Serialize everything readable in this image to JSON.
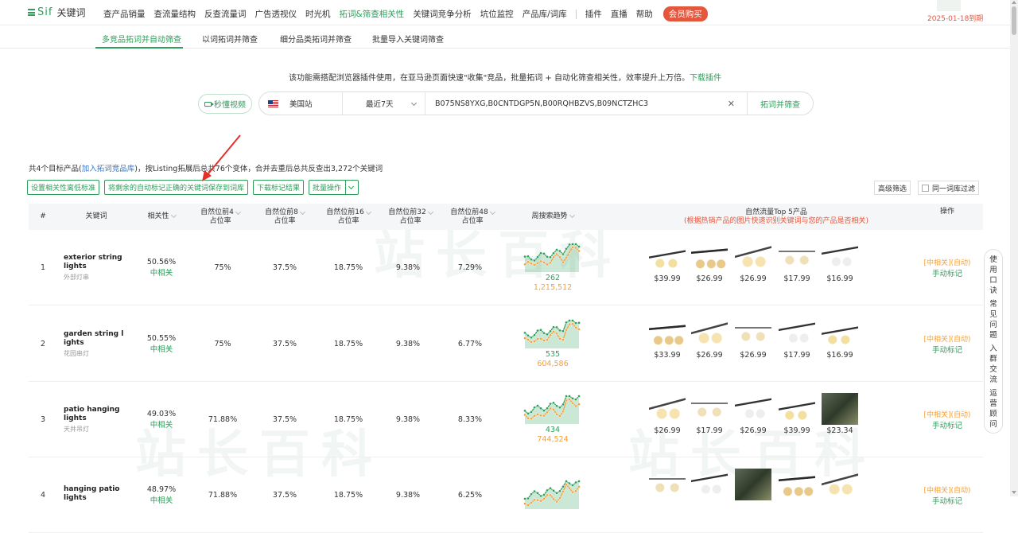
{
  "header": {
    "logo_brand": "Sif",
    "logo_sub": "关键词",
    "nav": [
      "查产品销量",
      "查流量结构",
      "反查流量词",
      "广告透视仪",
      "时光机",
      "拓词&筛查相关性",
      "关键词竞争分析",
      "坑位监控",
      "产品库/词库"
    ],
    "nav_right": [
      "插件",
      "直播",
      "帮助"
    ],
    "vip_label": "会员购买",
    "date": "2025-01-18到期"
  },
  "subnav": [
    "多竞品拓词并自动筛查",
    "以词拓词并筛查",
    "细分品类拓词并筛查",
    "批量导入关键词筛查"
  ],
  "intro": {
    "text": "该功能需搭配浏览器插件使用，在亚马逊页面快速\"收集\"竞品，批量拓词 + 自动化筛查相关性，效率提升上万倍。",
    "link": "下载插件"
  },
  "search": {
    "video_btn": "秒懂视频",
    "site": "美国站",
    "range": "最近7天",
    "asins": "B075NS8YXG,B0CNTDGP5N,B00RQHBZVS,B09NCTZHC3",
    "submit": "拓词并筛查"
  },
  "summary": {
    "prefix": "共4个目标产品(",
    "link": "加入拓词竞品库",
    "suffix": ")，按Listing拓展后总共76个变体，合并去重后总共反查出3,272个关键词"
  },
  "actions": {
    "set_standard": "设置相关性离低标准",
    "save_rest": "将剩余的自动标记正确的关键词保存到词库",
    "download": "下载标记结果",
    "batch": "批量操作"
  },
  "filters": {
    "advanced": "高级筛选",
    "same_lib": "同一词库过滤"
  },
  "columns": {
    "idx": "#",
    "keyword": "关键词",
    "relevance": "相关性",
    "top4_a": "自然位前4",
    "top4_b": "占位率",
    "top8_a": "自然位前8",
    "top8_b": "占位率",
    "top16_a": "自然位前16",
    "top16_b": "占位率",
    "top32_a": "自然位前32",
    "top32_b": "占位率",
    "top48_a": "自然位前48",
    "top48_b": "占位率",
    "trend": "周搜索趋势",
    "top5": "自然流量Top 5产品",
    "top5_note": "(根据热销产品的图片快速识别关键词与您的产品是否相关)",
    "op": "操作"
  },
  "rows": [
    {
      "idx": "1",
      "kw": "exterior string lights",
      "cn": "外部灯串",
      "rel": "50.56%",
      "lvl": "中相关",
      "t4": "75%",
      "t8": "37.5%",
      "t16": "18.75%",
      "t32": "9.38%",
      "t48": "7.29%",
      "rank": "262",
      "vol": "1,215,512",
      "prices": [
        "$39.99",
        "$26.99",
        "$26.99",
        "$17.99",
        "$16.99"
      ],
      "op_a": "[中相关](自动)",
      "op_b": "手动标记"
    },
    {
      "idx": "2",
      "kw": "garden string lights",
      "cn": "花园串灯",
      "rel": "50.55%",
      "lvl": "中相关",
      "t4": "75%",
      "t8": "37.5%",
      "t16": "18.75%",
      "t32": "9.38%",
      "t48": "6.77%",
      "rank": "535",
      "vol": "604,586",
      "prices": [
        "$33.99",
        "$26.99",
        "$26.99",
        "$17.99",
        "$16.99"
      ],
      "op_a": "[中相关](自动)",
      "op_b": "手动标记"
    },
    {
      "idx": "3",
      "kw": "patio hanging lights",
      "cn": "天井吊灯",
      "rel": "49.03%",
      "lvl": "中相关",
      "t4": "71.88%",
      "t8": "37.5%",
      "t16": "18.75%",
      "t32": "9.38%",
      "t48": "8.33%",
      "rank": "434",
      "vol": "744,524",
      "prices": [
        "$26.99",
        "$17.99",
        "$26.99",
        "$39.99",
        "$23.34"
      ],
      "op_a": "[中相关](自动)",
      "op_b": "手动标记"
    },
    {
      "idx": "4",
      "kw": "hanging patio lights",
      "cn": "",
      "rel": "48.97%",
      "lvl": "中相关",
      "t4": "71.88%",
      "t8": "37.5%",
      "t16": "18.75%",
      "t32": "9.38%",
      "t48": "6.25%",
      "rank": "",
      "vol": "",
      "prices": [
        "",
        "",
        "",
        "",
        ""
      ],
      "op_a": "[中相关](自动)",
      "op_b": "手动标记"
    }
  ],
  "side": [
    "使用口诀",
    "常见问题",
    "入群交流",
    "运营顾问"
  ],
  "colors": {
    "accent": "#2e9e5b",
    "warn": "#e4573d",
    "orange": "#f5a13a",
    "link": "#3576c9"
  },
  "icons": [
    "camera-icon",
    "us-flag-icon",
    "chevron-down-icon",
    "clear-icon",
    "sort-icon",
    "checkbox-icon",
    "annotation-arrow",
    "product-image"
  ]
}
